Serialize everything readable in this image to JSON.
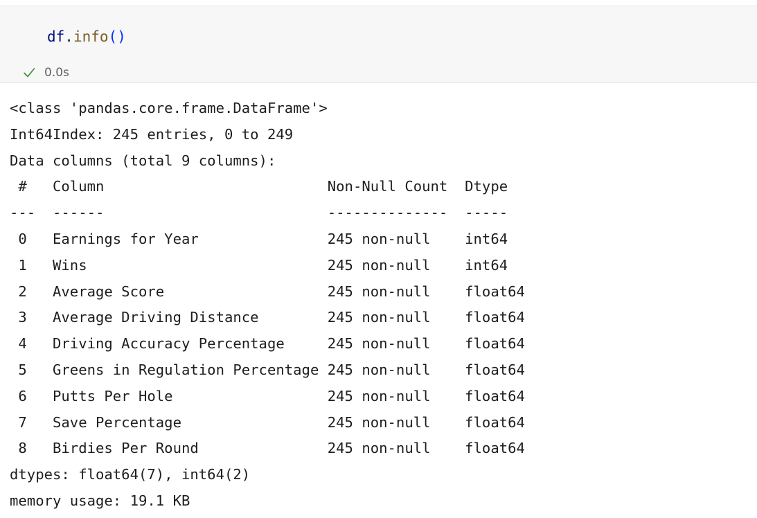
{
  "cell": {
    "code": {
      "object_name": "df",
      "dot": ".",
      "method_name": "info",
      "open_paren": "(",
      "close_paren": ")"
    },
    "status": {
      "icon": "check-icon",
      "icon_color": "#388a34",
      "duration": "0.0s"
    },
    "output_lines": [
      "<class 'pandas.core.frame.DataFrame'>",
      "Int64Index: 245 entries, 0 to 249",
      "Data columns (total 9 columns):",
      " #   Column                          Non-Null Count  Dtype  ",
      "---  ------                          --------------  -----  ",
      " 0   Earnings for Year               245 non-null    int64  ",
      " 1   Wins                            245 non-null    int64  ",
      " 2   Average Score                   245 non-null    float64",
      " 3   Average Driving Distance        245 non-null    float64",
      " 4   Driving Accuracy Percentage     245 non-null    float64",
      " 5   Greens in Regulation Percentage 245 non-null    float64",
      " 6   Putts Per Hole                  245 non-null    float64",
      " 7   Save Percentage                 245 non-null    float64",
      " 8   Birdies Per Round               245 non-null    float64",
      "dtypes: float64(7), int64(2)",
      "memory usage: 19.1 KB"
    ]
  },
  "colors": {
    "input_background": "#f7f7f7",
    "output_text": "#1e1e1e",
    "variable": "#001080",
    "function": "#795e26",
    "paren": "#0431fa",
    "muted_text": "#616161"
  }
}
